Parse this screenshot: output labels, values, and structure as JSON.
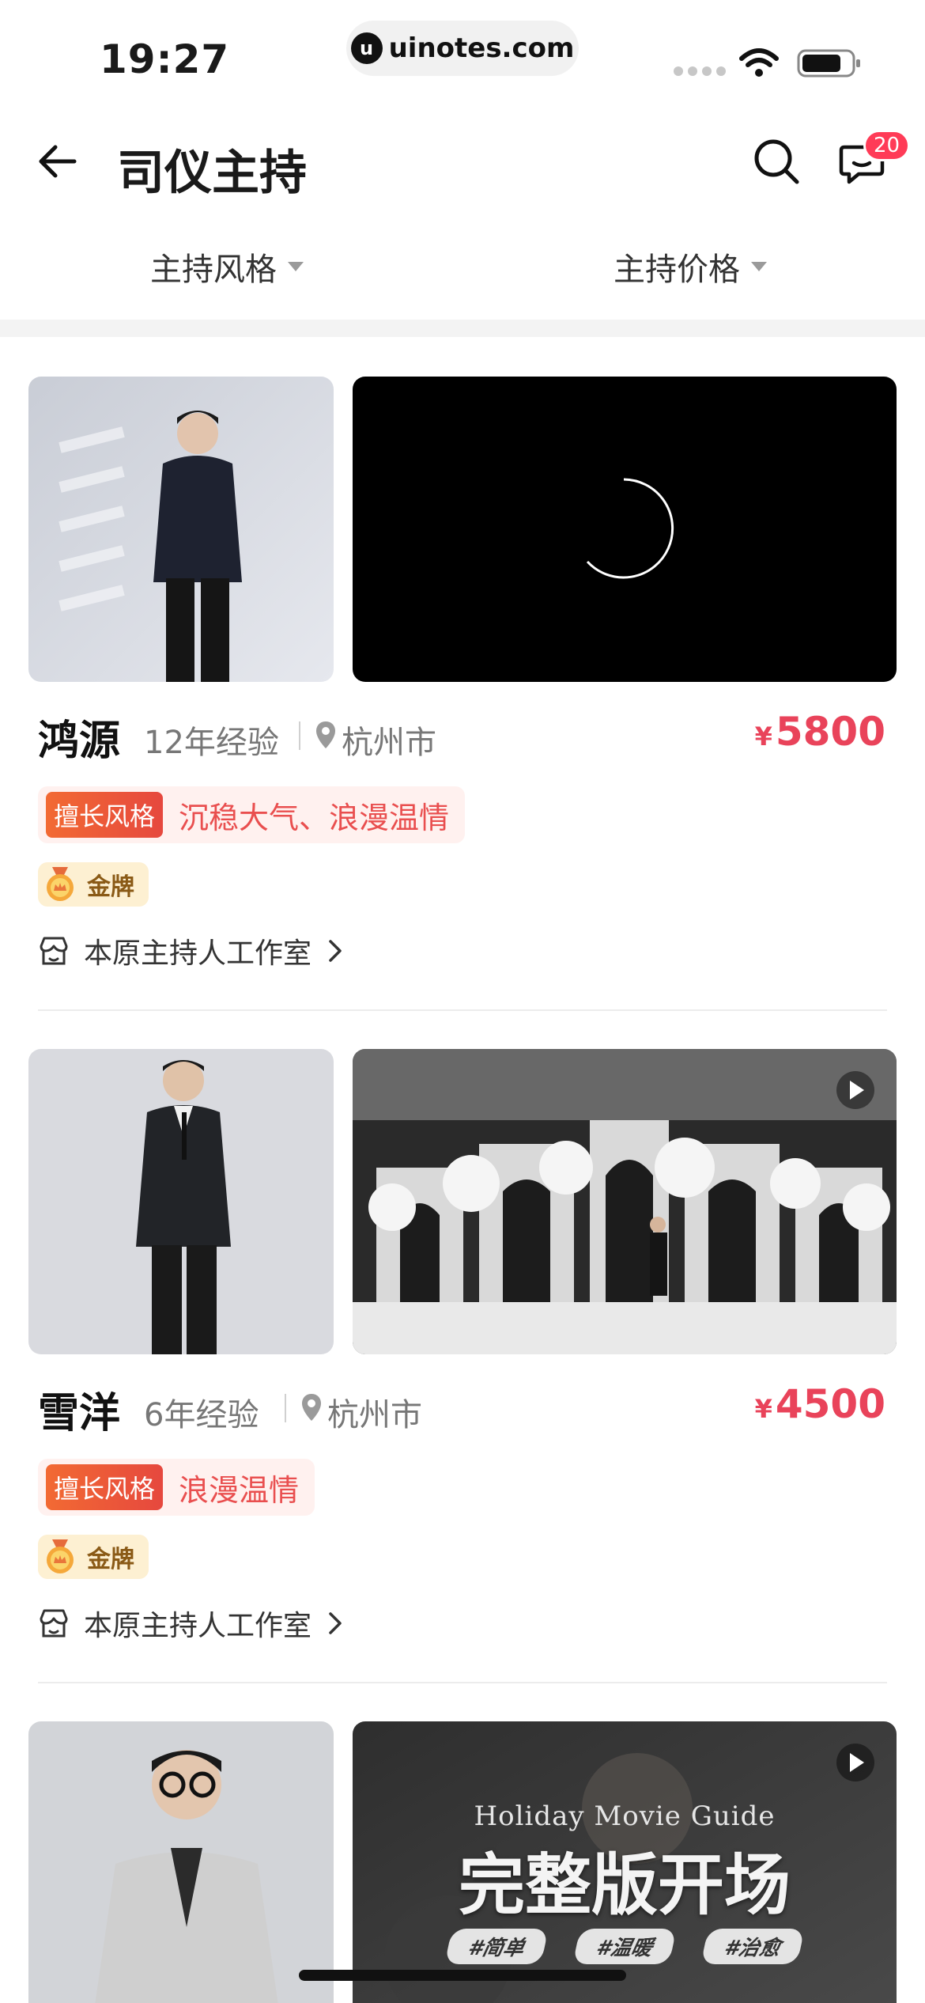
{
  "status_bar": {
    "time": "19:27",
    "url": "uinotes.com",
    "url_logo": "u"
  },
  "header": {
    "title": "司仪主持",
    "message_badge": "20"
  },
  "filters": [
    {
      "label": "主持风格"
    },
    {
      "label": "主持价格"
    }
  ],
  "hosts": [
    {
      "name": "鸿源",
      "experience": "12年经验",
      "city": "杭州市",
      "currency": "¥",
      "price": "5800",
      "style_tag": "擅长风格",
      "style": "沉稳大气、浪漫温情",
      "medal": "金牌",
      "studio": "本原主持人工作室"
    },
    {
      "name": "雪洋",
      "experience": "6年经验",
      "city": "杭州市",
      "currency": "¥",
      "price": "4500",
      "style_tag": "擅长风格",
      "style": "浪漫温情",
      "medal": "金牌",
      "studio": "本原主持人工作室"
    }
  ],
  "poster": {
    "subtitle": "Holiday Movie Guide",
    "title": "完整版开场",
    "tags": [
      "#简单",
      "#温暖",
      "#治愈"
    ]
  },
  "colors": {
    "accent": "#e9435a",
    "badge": "#ff3b57",
    "style_tag": "#f26a33",
    "gold_bg": "#fdf0d2"
  }
}
